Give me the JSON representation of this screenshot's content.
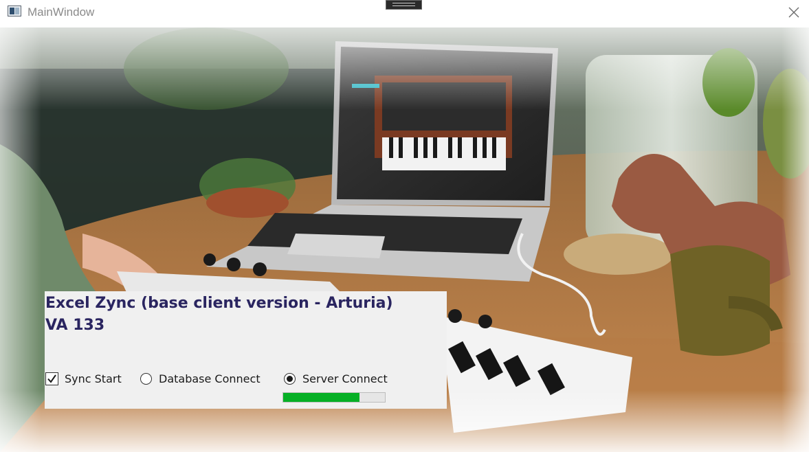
{
  "window": {
    "title": "MainWindow",
    "icons": {
      "app": "app-window-icon",
      "close": "close-icon"
    }
  },
  "panel": {
    "title_line1": "Excel Zync (base client version - Arturia)",
    "title_line2": "VA 133",
    "title_color": "#2a2560",
    "sync_start": {
      "label": "Sync Start",
      "checked": true
    },
    "database_connect": {
      "label": "Database Connect",
      "selected": false
    },
    "server_connect": {
      "label": "Server Connect",
      "selected": true
    },
    "progress": {
      "value_percent": 75,
      "color": "#06b025"
    }
  }
}
